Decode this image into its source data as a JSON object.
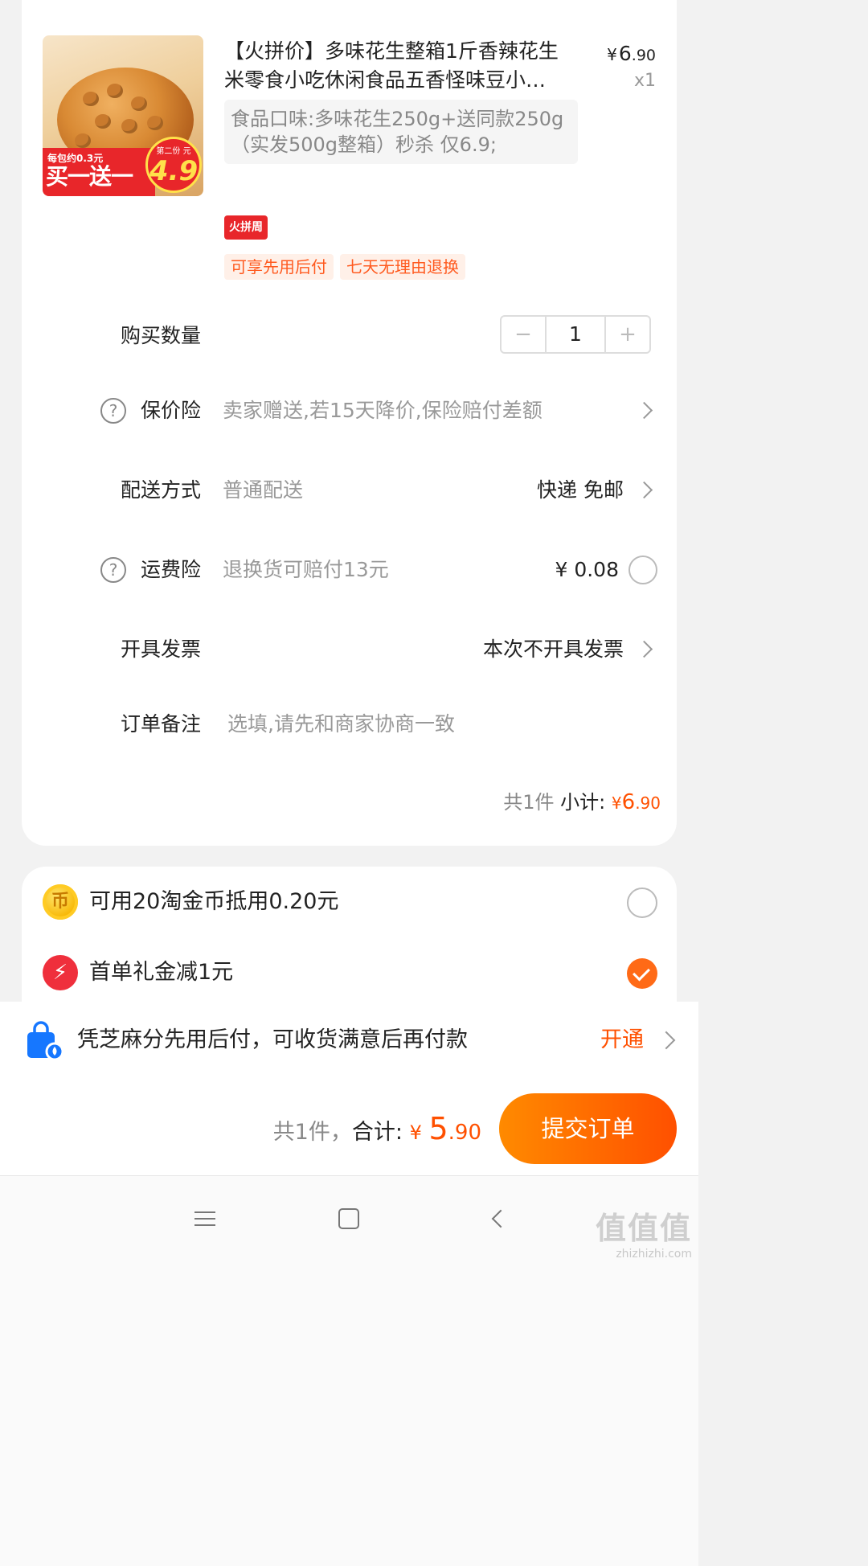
{
  "product": {
    "title": "【火拼价】多味花生整箱1斤香辣花生米零食小吃休闲食品五香怪味豆小…",
    "price_currency": "¥",
    "price_int": "6",
    "price_dec": ".90",
    "quantity_label": "x1",
    "spec": "食品口味:多味花生250g+送同款250g（实发500g整箱）秒杀 仅6.9;",
    "image": {
      "banner_top": "每包约0.3元",
      "banner_main": "买一送一",
      "badge_label": "第二份 元",
      "badge_value": "4.9"
    },
    "fire_tag": "火拼周",
    "tags": [
      "可享先用后付",
      "七天无理由退换"
    ]
  },
  "quantity": {
    "label": "购买数量",
    "value": "1",
    "minus": "−",
    "plus": "+"
  },
  "price_protection": {
    "label": "保价险",
    "desc": "卖家赠送,若15天降价,保险赔付差额"
  },
  "delivery": {
    "label": "配送方式",
    "desc": "普通配送",
    "value": "快递 免邮"
  },
  "shipping_insurance": {
    "label": "运费险",
    "desc": "退换货可赔付13元",
    "value": "¥ 0.08"
  },
  "invoice": {
    "label": "开具发票",
    "value": "本次不开具发票"
  },
  "note": {
    "label": "订单备注",
    "placeholder": "选填,请先和商家协商一致"
  },
  "subtotal": {
    "count": "共1件",
    "label": "小计:",
    "currency": "¥",
    "int": "6",
    "dec": ".90"
  },
  "discounts": [
    {
      "label": "可用20淘金币抵用0.20元",
      "icon": "coin-icon",
      "icon_glyph": "币",
      "checked": false
    },
    {
      "label": "首单礼金减1元",
      "icon": "bolt-icon",
      "icon_glyph": "⚡",
      "checked": true
    }
  ],
  "promo": {
    "text": "凭芝麻分先用后付，可收货满意后再付款",
    "action": "开通"
  },
  "checkout": {
    "count": "共1件，",
    "label": "合计:",
    "currency": "¥",
    "int": "5",
    "dec": ".90",
    "submit": "提交订单"
  },
  "watermark": {
    "big": "值值值",
    "small": "zhizhizhi.com"
  },
  "colors": {
    "accent": "#ff5000",
    "accent_gradient_start": "#ff8a00",
    "tag_bg": "#fff0e8",
    "fire_tag": "#e8262a"
  }
}
